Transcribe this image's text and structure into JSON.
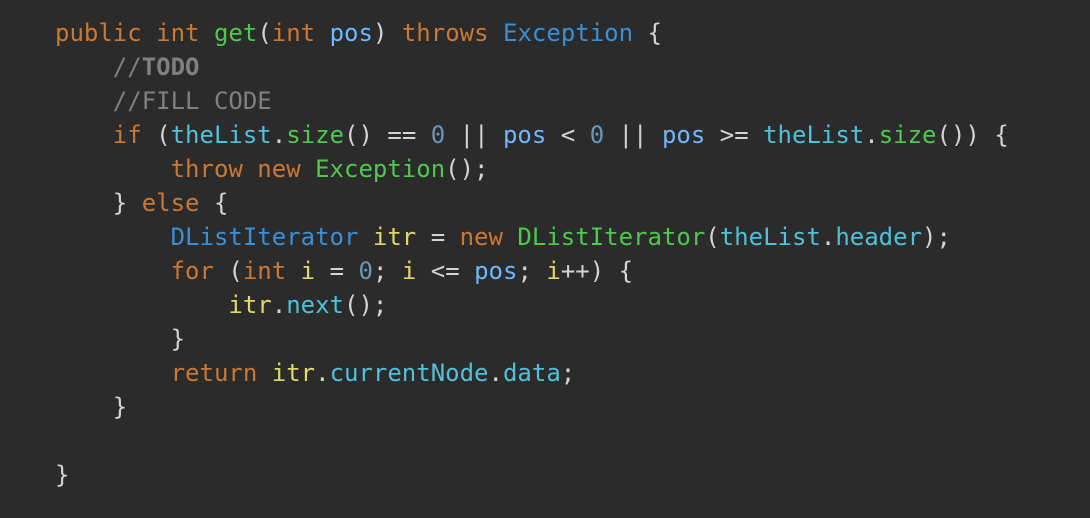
{
  "colors": {
    "background": "#2b2b2b",
    "keyword": "#cc7832",
    "method": "#4ec94e",
    "class_name": "#3b8fd6",
    "variable": "#6fb8ff",
    "field": "#4fc1d9",
    "number": "#6897bb",
    "comment": "#808080",
    "operator": "#d4d4d4",
    "local_var": "#e0d86a"
  },
  "code_lines": [
    {
      "indent": 0,
      "tokens": [
        {
          "text": "public",
          "kind": "keyword"
        },
        {
          "text": " ",
          "kind": "plain"
        },
        {
          "text": "int",
          "kind": "keyword"
        },
        {
          "text": " ",
          "kind": "plain"
        },
        {
          "text": "get",
          "kind": "method"
        },
        {
          "text": "(",
          "kind": "plain"
        },
        {
          "text": "int",
          "kind": "keyword"
        },
        {
          "text": " ",
          "kind": "plain"
        },
        {
          "text": "pos",
          "kind": "variable"
        },
        {
          "text": ") ",
          "kind": "plain"
        },
        {
          "text": "throws",
          "kind": "keyword"
        },
        {
          "text": " ",
          "kind": "plain"
        },
        {
          "text": "Exception",
          "kind": "class_name"
        },
        {
          "text": " {",
          "kind": "plain"
        }
      ]
    },
    {
      "indent": 1,
      "tokens": [
        {
          "text": "//",
          "kind": "comment"
        },
        {
          "text": "TODO",
          "kind": "comment_bold"
        }
      ]
    },
    {
      "indent": 1,
      "tokens": [
        {
          "text": "//FILL CODE",
          "kind": "comment"
        }
      ]
    },
    {
      "indent": 1,
      "tokens": [
        {
          "text": "if",
          "kind": "keyword"
        },
        {
          "text": " (",
          "kind": "plain"
        },
        {
          "text": "theList",
          "kind": "field"
        },
        {
          "text": ".",
          "kind": "plain"
        },
        {
          "text": "size",
          "kind": "method"
        },
        {
          "text": "() == ",
          "kind": "plain"
        },
        {
          "text": "0",
          "kind": "number"
        },
        {
          "text": " || ",
          "kind": "plain"
        },
        {
          "text": "pos",
          "kind": "variable"
        },
        {
          "text": " < ",
          "kind": "plain"
        },
        {
          "text": "0",
          "kind": "number"
        },
        {
          "text": " || ",
          "kind": "plain"
        },
        {
          "text": "pos",
          "kind": "variable"
        },
        {
          "text": " >= ",
          "kind": "plain"
        },
        {
          "text": "theList",
          "kind": "field"
        },
        {
          "text": ".",
          "kind": "plain"
        },
        {
          "text": "size",
          "kind": "method"
        },
        {
          "text": "()) {",
          "kind": "plain"
        }
      ]
    },
    {
      "indent": 2,
      "tokens": [
        {
          "text": "throw",
          "kind": "keyword"
        },
        {
          "text": " ",
          "kind": "plain"
        },
        {
          "text": "new",
          "kind": "keyword"
        },
        {
          "text": " ",
          "kind": "plain"
        },
        {
          "text": "Exception",
          "kind": "method"
        },
        {
          "text": "();",
          "kind": "plain"
        }
      ]
    },
    {
      "indent": 1,
      "tokens": [
        {
          "text": "} ",
          "kind": "plain"
        },
        {
          "text": "else",
          "kind": "keyword"
        },
        {
          "text": " {",
          "kind": "plain"
        }
      ]
    },
    {
      "indent": 2,
      "tokens": [
        {
          "text": "DListIterator",
          "kind": "class_name"
        },
        {
          "text": " ",
          "kind": "plain"
        },
        {
          "text": "itr",
          "kind": "local_var"
        },
        {
          "text": " = ",
          "kind": "plain"
        },
        {
          "text": "new",
          "kind": "keyword"
        },
        {
          "text": " ",
          "kind": "plain"
        },
        {
          "text": "DListIterator",
          "kind": "method"
        },
        {
          "text": "(",
          "kind": "plain"
        },
        {
          "text": "theList",
          "kind": "field"
        },
        {
          "text": ".",
          "kind": "plain"
        },
        {
          "text": "header",
          "kind": "field"
        },
        {
          "text": ");",
          "kind": "plain"
        }
      ]
    },
    {
      "indent": 2,
      "tokens": [
        {
          "text": "for",
          "kind": "keyword"
        },
        {
          "text": " (",
          "kind": "plain"
        },
        {
          "text": "int",
          "kind": "keyword"
        },
        {
          "text": " ",
          "kind": "plain"
        },
        {
          "text": "i",
          "kind": "local_var"
        },
        {
          "text": " = ",
          "kind": "plain"
        },
        {
          "text": "0",
          "kind": "number"
        },
        {
          "text": "; ",
          "kind": "plain"
        },
        {
          "text": "i",
          "kind": "local_var"
        },
        {
          "text": " <= ",
          "kind": "plain"
        },
        {
          "text": "pos",
          "kind": "variable"
        },
        {
          "text": "; ",
          "kind": "plain"
        },
        {
          "text": "i",
          "kind": "local_var"
        },
        {
          "text": "++) {",
          "kind": "plain"
        }
      ]
    },
    {
      "indent": 3,
      "tokens": [
        {
          "text": "itr",
          "kind": "local_var"
        },
        {
          "text": ".",
          "kind": "plain"
        },
        {
          "text": "next",
          "kind": "field"
        },
        {
          "text": "();",
          "kind": "plain"
        }
      ]
    },
    {
      "indent": 2,
      "tokens": [
        {
          "text": "}",
          "kind": "plain"
        }
      ]
    },
    {
      "indent": 2,
      "tokens": [
        {
          "text": "return",
          "kind": "keyword"
        },
        {
          "text": " ",
          "kind": "plain"
        },
        {
          "text": "itr",
          "kind": "local_var"
        },
        {
          "text": ".",
          "kind": "plain"
        },
        {
          "text": "currentNode",
          "kind": "field"
        },
        {
          "text": ".",
          "kind": "plain"
        },
        {
          "text": "data",
          "kind": "field"
        },
        {
          "text": ";",
          "kind": "plain"
        }
      ]
    },
    {
      "indent": 1,
      "tokens": [
        {
          "text": "}",
          "kind": "plain"
        }
      ]
    },
    {
      "indent": 0,
      "tokens": []
    },
    {
      "indent": 0,
      "tokens": [
        {
          "text": "}",
          "kind": "plain"
        }
      ]
    }
  ]
}
